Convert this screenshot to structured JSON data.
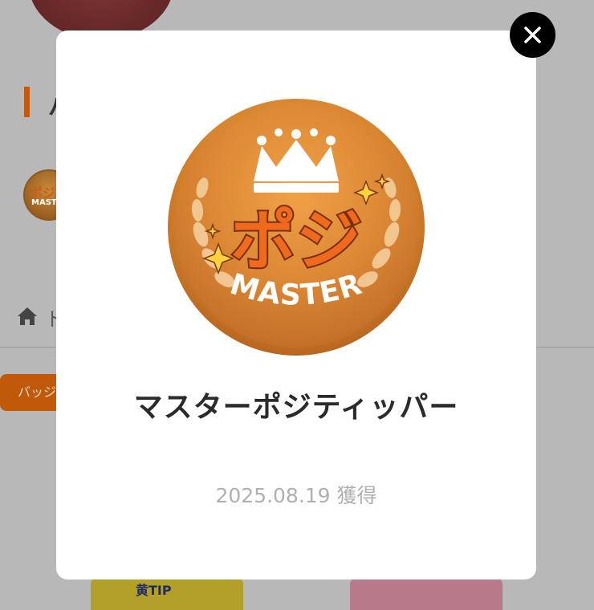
{
  "background": {
    "section_title": "バ",
    "small_badge_top": "ポジ",
    "small_badge_bottom": "MASTE",
    "breadcrumb_home": "ト",
    "tab_label": "バッジ",
    "bottom_card_label": "黄TIP"
  },
  "modal": {
    "badge_name": "マスターポジティッパー",
    "acquired_text": "2025.08.19 獲得",
    "medal": {
      "logo_text": "ポジ",
      "ribbon_text": "MASTER"
    },
    "close_icon": "close-icon"
  },
  "colors": {
    "overlay": "#b8b8b8",
    "medal_gold": "#e0913a",
    "logo_orange": "#ef6a1c",
    "accent": "#c65a0a"
  }
}
